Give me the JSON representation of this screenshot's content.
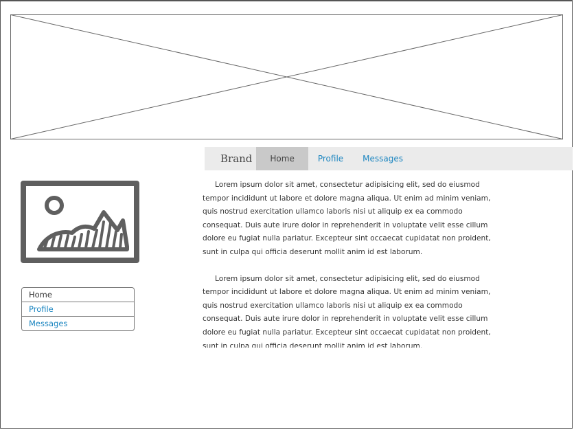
{
  "navbar": {
    "brand": "Brand",
    "items": [
      {
        "label": "Home",
        "active": true
      },
      {
        "label": "Profile",
        "active": false
      },
      {
        "label": "Messages",
        "active": false
      }
    ]
  },
  "sidebar": {
    "items": [
      {
        "label": "Home"
      },
      {
        "label": "Profile"
      },
      {
        "label": "Messages"
      }
    ]
  },
  "content": {
    "paragraphs": [
      "Lorem ipsum dolor sit amet, consectetur adipisicing elit, sed do eiusmod tempor incididunt ut labore et dolore magna aliqua. Ut enim ad minim veniam, quis nostrud exercitation ullamco laboris nisi ut aliquip ex ea commodo consequat. Duis aute irure dolor in reprehenderit in voluptate velit esse cillum dolore eu fugiat nulla pariatur. Excepteur sint occaecat cupidatat non proident, sunt in culpa qui officia deserunt mollit anim id est laborum.",
      "Lorem ipsum dolor sit amet, consectetur adipisicing elit, sed do eiusmod tempor incididunt ut labore et dolore magna aliqua. Ut enim ad minim veniam, quis nostrud exercitation ullamco laboris nisi ut aliquip ex ea commodo consequat. Duis aute irure dolor in reprehenderit in voluptate velit esse cillum dolore eu fugiat nulla pariatur. Excepteur sint occaecat cupidatat non proident, sunt in culpa qui officia deserunt mollit anim id est laborum."
    ]
  },
  "colors": {
    "link": "#1b85c0",
    "navbar_bg": "#ebebeb",
    "active_tab": "#c9c9c9"
  },
  "icons": [
    "image-placeholder-icon"
  ]
}
